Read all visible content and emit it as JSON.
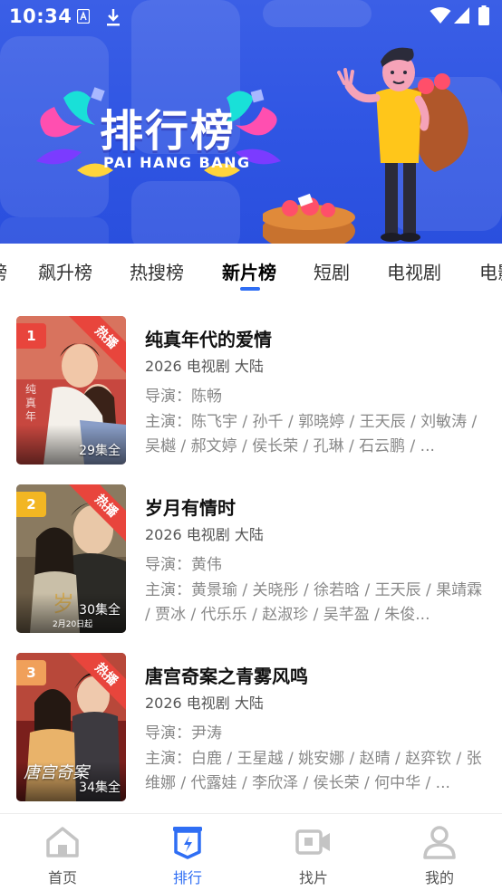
{
  "status_bar": {
    "time": "10:34",
    "icons": [
      "app-notification-icon",
      "download-icon",
      "wifi-icon",
      "signal-icon",
      "battery-icon"
    ]
  },
  "banner": {
    "title": "排行榜",
    "subtitle": "PAI HANG BANG",
    "background_color": "#2f55e3"
  },
  "tabs": {
    "items": [
      {
        "label": "榜"
      },
      {
        "label": "飙升榜"
      },
      {
        "label": "热搜榜"
      },
      {
        "label": "新片榜"
      },
      {
        "label": "短剧"
      },
      {
        "label": "电视剧"
      },
      {
        "label": "电影"
      }
    ],
    "active_label": "新片榜",
    "accent_color": "#2f6ef4"
  },
  "list": {
    "items": [
      {
        "rank": "1",
        "rank_color": "#e8453c",
        "hot_tag": "热播",
        "episodes": "29集全",
        "title": "纯真年代的爱情",
        "meta": "2026  电视剧  大陆",
        "director": "导演：陈畅",
        "cast": "主演：陈飞宇 / 孙千 / 郭晓婷 / 王天辰 / 刘敏涛 / 吴樾 / 郝文婷 / 侯长荣 / 孔琳 / 石云鹏 / ..."
      },
      {
        "rank": "2",
        "rank_color": "#f2b623",
        "hot_tag": "热播",
        "episodes": "30集全",
        "poster_caption": "2月20日起",
        "title": "岁月有情时",
        "meta": "2026  电视剧  大陆",
        "director": "导演：黄伟",
        "cast": "主演：黄景瑜 / 关晓彤 / 徐若晗 / 王天辰 / 果靖霖 / 贾冰 / 代乐乐 / 赵淑珍 / 吴芊盈 / 朱俊..."
      },
      {
        "rank": "3",
        "rank_color": "#f0a05a",
        "hot_tag": "热播",
        "episodes": "34集全",
        "poster_caption": "唐宫奇案",
        "title": "唐宫奇案之青雾风鸣",
        "meta": "2026  电视剧  大陆",
        "director": "导演：尹涛",
        "cast": "主演：白鹿 / 王星越 / 姚安娜 / 赵晴 / 赵弈钦 / 张维娜 / 代露娃 / 李欣泽 / 侯长荣 / 何中华 / ..."
      }
    ]
  },
  "bottom_nav": {
    "items": [
      {
        "label": "首页",
        "icon": "home-icon"
      },
      {
        "label": "排行",
        "icon": "ranking-icon"
      },
      {
        "label": "找片",
        "icon": "video-camera-icon"
      },
      {
        "label": "我的",
        "icon": "profile-icon"
      }
    ],
    "active_label": "排行",
    "active_color": "#2f6ef4",
    "inactive_color": "#c4c4c4"
  }
}
